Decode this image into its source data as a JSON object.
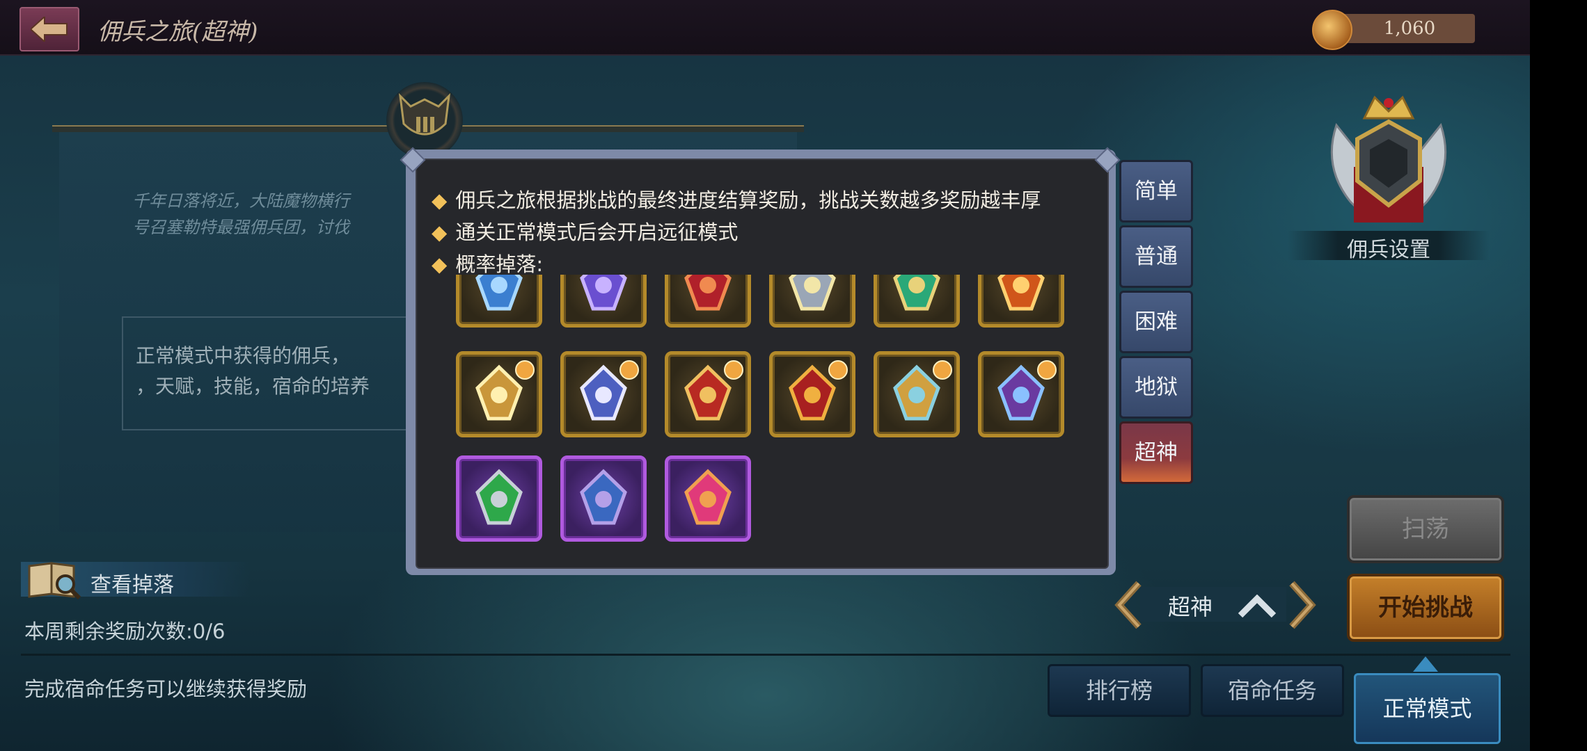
{
  "header": {
    "title": "佣兵之旅(超神)",
    "coins": "1,060"
  },
  "background": {
    "story_lines": "千年日落将近，大陆魔物横行\n号召塞勒特最强佣兵团，讨伐",
    "info_lines": "正常模式中获得的佣兵，",
    "info_lines_2": "，天赋，技能，宿命的培养"
  },
  "left_panel": {
    "view_drops": "查看掉落",
    "weekly_rewards": "本周剩余奖励次数:0/6",
    "fate_tip": "完成宿命任务可以继续获得奖励"
  },
  "right_panel": {
    "mercenary_settings": "佣兵设置",
    "sweep": "扫荡",
    "start_challenge": "开始挑战",
    "difficulty_selected": "超神"
  },
  "bottom_tabs": {
    "leaderboard": "排行榜",
    "fate_quests": "宿命任务",
    "normal_mode": "正常模式"
  },
  "popup": {
    "rules": [
      "佣兵之旅根据挑战的最终进度结算奖励，挑战关数越多奖励越丰厚",
      "通关正常模式后会开启远征模式",
      "概率掉落:"
    ],
    "rule_bullet": "◆",
    "items": [
      {
        "row": 0,
        "col": 0,
        "rarity": "gold",
        "icon": "blue-sword-icon"
      },
      {
        "row": 0,
        "col": 1,
        "rarity": "gold",
        "icon": "violet-sword-icon"
      },
      {
        "row": 0,
        "col": 2,
        "rarity": "gold",
        "icon": "red-sword-icon"
      },
      {
        "row": 0,
        "col": 3,
        "rarity": "gold",
        "icon": "silver-sword-icon"
      },
      {
        "row": 0,
        "col": 4,
        "rarity": "gold",
        "icon": "green-crossbow-icon"
      },
      {
        "row": 0,
        "col": 5,
        "rarity": "gold",
        "icon": "flame-axe-icon"
      },
      {
        "row": 1,
        "col": 0,
        "rarity": "gold",
        "icon": "gold-armor-icon"
      },
      {
        "row": 1,
        "col": 1,
        "rarity": "gold",
        "icon": "winged-robe-icon"
      },
      {
        "row": 1,
        "col": 2,
        "rarity": "gold",
        "icon": "red-helmet-icon"
      },
      {
        "row": 1,
        "col": 3,
        "rarity": "gold",
        "icon": "red-boots-icon"
      },
      {
        "row": 1,
        "col": 4,
        "rarity": "gold",
        "icon": "dragon-ring-icon"
      },
      {
        "row": 1,
        "col": 5,
        "rarity": "gold",
        "icon": "gem-necklace-icon"
      },
      {
        "row": 2,
        "col": 0,
        "rarity": "purple",
        "icon": "green-blade-icon"
      },
      {
        "row": 2,
        "col": 1,
        "rarity": "purple",
        "icon": "crystal-ore-icon"
      },
      {
        "row": 2,
        "col": 2,
        "rarity": "purple",
        "icon": "pink-gem-icon"
      }
    ],
    "difficulty_tabs": [
      "简单",
      "普通",
      "困难",
      "地狱",
      "超神"
    ],
    "active_difficulty": "超神"
  },
  "colors": {
    "gold_frame": "#b48a2a",
    "purple_frame": "#b05adf",
    "bullet": "#f2c15a",
    "popup_border": "#7e8aa8"
  }
}
